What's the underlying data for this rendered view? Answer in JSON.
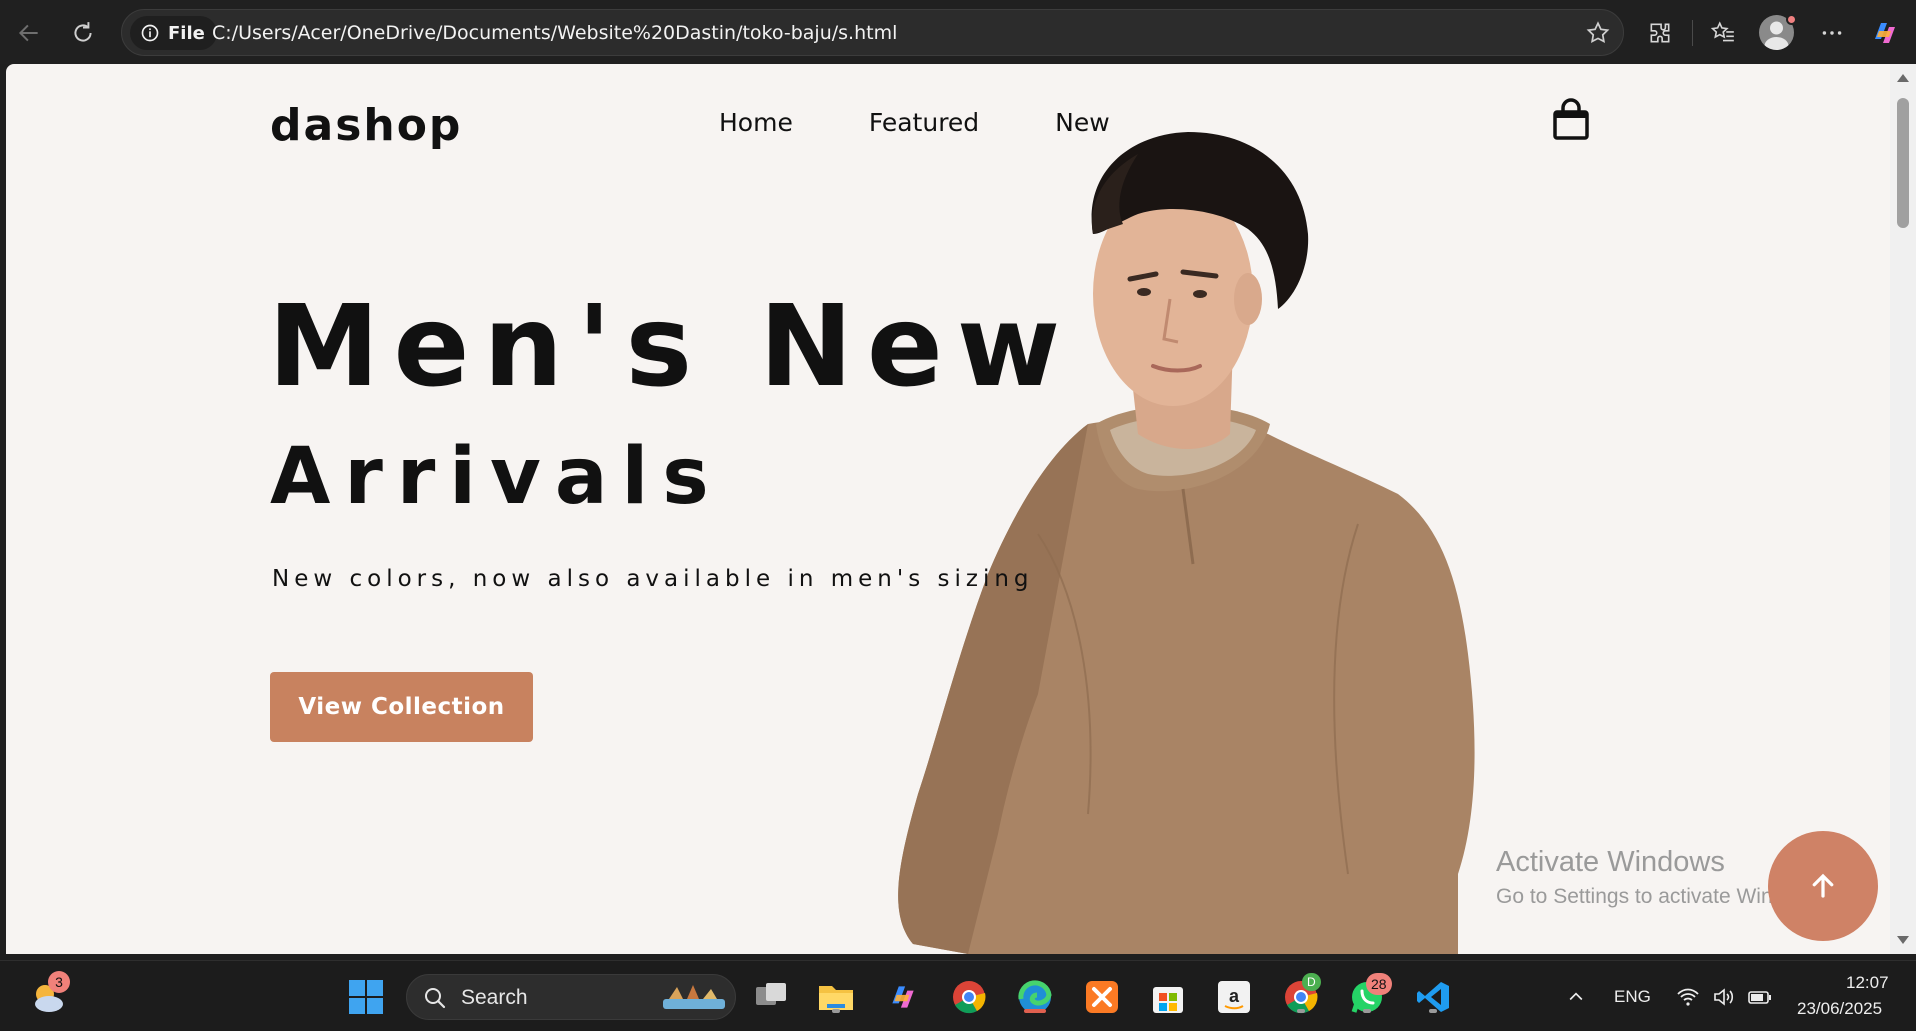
{
  "browser": {
    "url_chip_label": "File",
    "url": "C:/Users/Acer/OneDrive/Documents/Website%20Dastin/toko-baju/s.html"
  },
  "site": {
    "logo": "dashop",
    "nav": [
      {
        "label": "Home"
      },
      {
        "label": "Featured"
      },
      {
        "label": "New"
      }
    ],
    "hero": {
      "title_line1": "Men's New",
      "title_line2": "Arrivals",
      "subtitle": "New colors, now also available in men's sizing",
      "cta_label": "View Collection"
    },
    "accent_color": "#c8825f",
    "background_color": "#f7f4f2"
  },
  "watermark": {
    "title": "Activate Windows",
    "subtitle": "Go to Settings to activate Windows."
  },
  "taskbar": {
    "weather_badge": "3",
    "search_label": "Search",
    "whatsapp_badge": "28",
    "chrome_profile_badge": "D",
    "language": "ENG",
    "time": "12:07",
    "date": "23/06/2025"
  }
}
